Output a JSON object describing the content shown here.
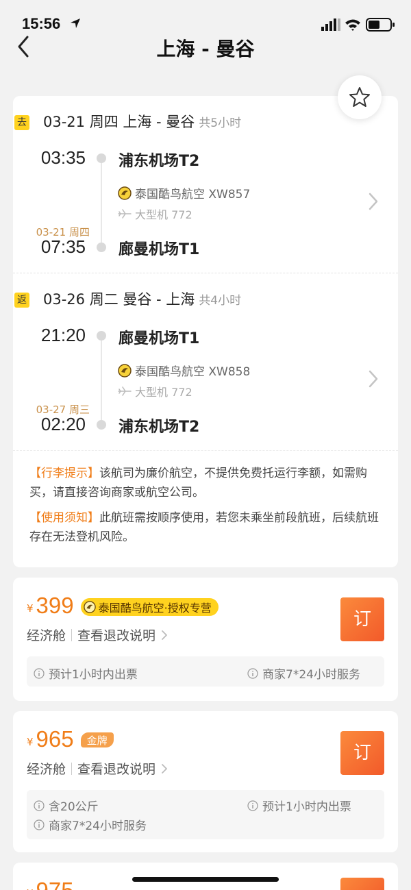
{
  "status_bar": {
    "time": "15:56"
  },
  "nav": {
    "title": "上海 - 曼谷"
  },
  "outbound": {
    "badge": "去",
    "header": "03-21  周四 上海 - 曼谷",
    "duration": "共5小时",
    "dep_time": "03:35",
    "dep_airport": "浦东机场T2",
    "airline": "泰国酷鸟航空 XW857",
    "aircraft": "大型机 772",
    "arr_date": "03-21 周四",
    "arr_time": "07:35",
    "arr_airport": "廊曼机场T1"
  },
  "return": {
    "badge": "返",
    "header": "03-26  周二 曼谷 - 上海",
    "duration": "共4小时",
    "dep_time": "21:20",
    "dep_airport": "廊曼机场T1",
    "airline": "泰国酷鸟航空 XW858",
    "aircraft": "大型机 772",
    "arr_date": "03-27 周三",
    "arr_time": "02:20",
    "arr_airport": "浦东机场T2"
  },
  "notes": [
    {
      "title": "【行李提示】",
      "text": "该航司为廉价航空，不提供免费托运行李额，如需购买，请直接咨询商家或航空公司。"
    },
    {
      "title": "【使用须知】",
      "text": "此航班需按顺序使用，若您未乘坐前段航班，后续航班存在无法登机风险。"
    }
  ],
  "offers": [
    {
      "currency": "¥",
      "price": "399",
      "tag": "泰国酷鸟航空·授权专营",
      "cabin": "经济舱",
      "rule_link": "查看退改说明",
      "book_label": "订",
      "info": [
        "预计1小时内出票",
        "商家7*24小时服务"
      ]
    },
    {
      "currency": "¥",
      "price": "965",
      "tag": "金牌",
      "cabin": "经济舱",
      "rule_link": "查看退改说明",
      "book_label": "订",
      "info": [
        "含20公斤",
        "预计1小时内出票",
        "商家7*24小时服务"
      ]
    },
    {
      "currency": "¥",
      "price": "975"
    }
  ],
  "colors": {
    "accent": "#f07d18",
    "badge": "#ffd21f",
    "button_from": "#fb8a3c",
    "button_to": "#f25a2a"
  }
}
